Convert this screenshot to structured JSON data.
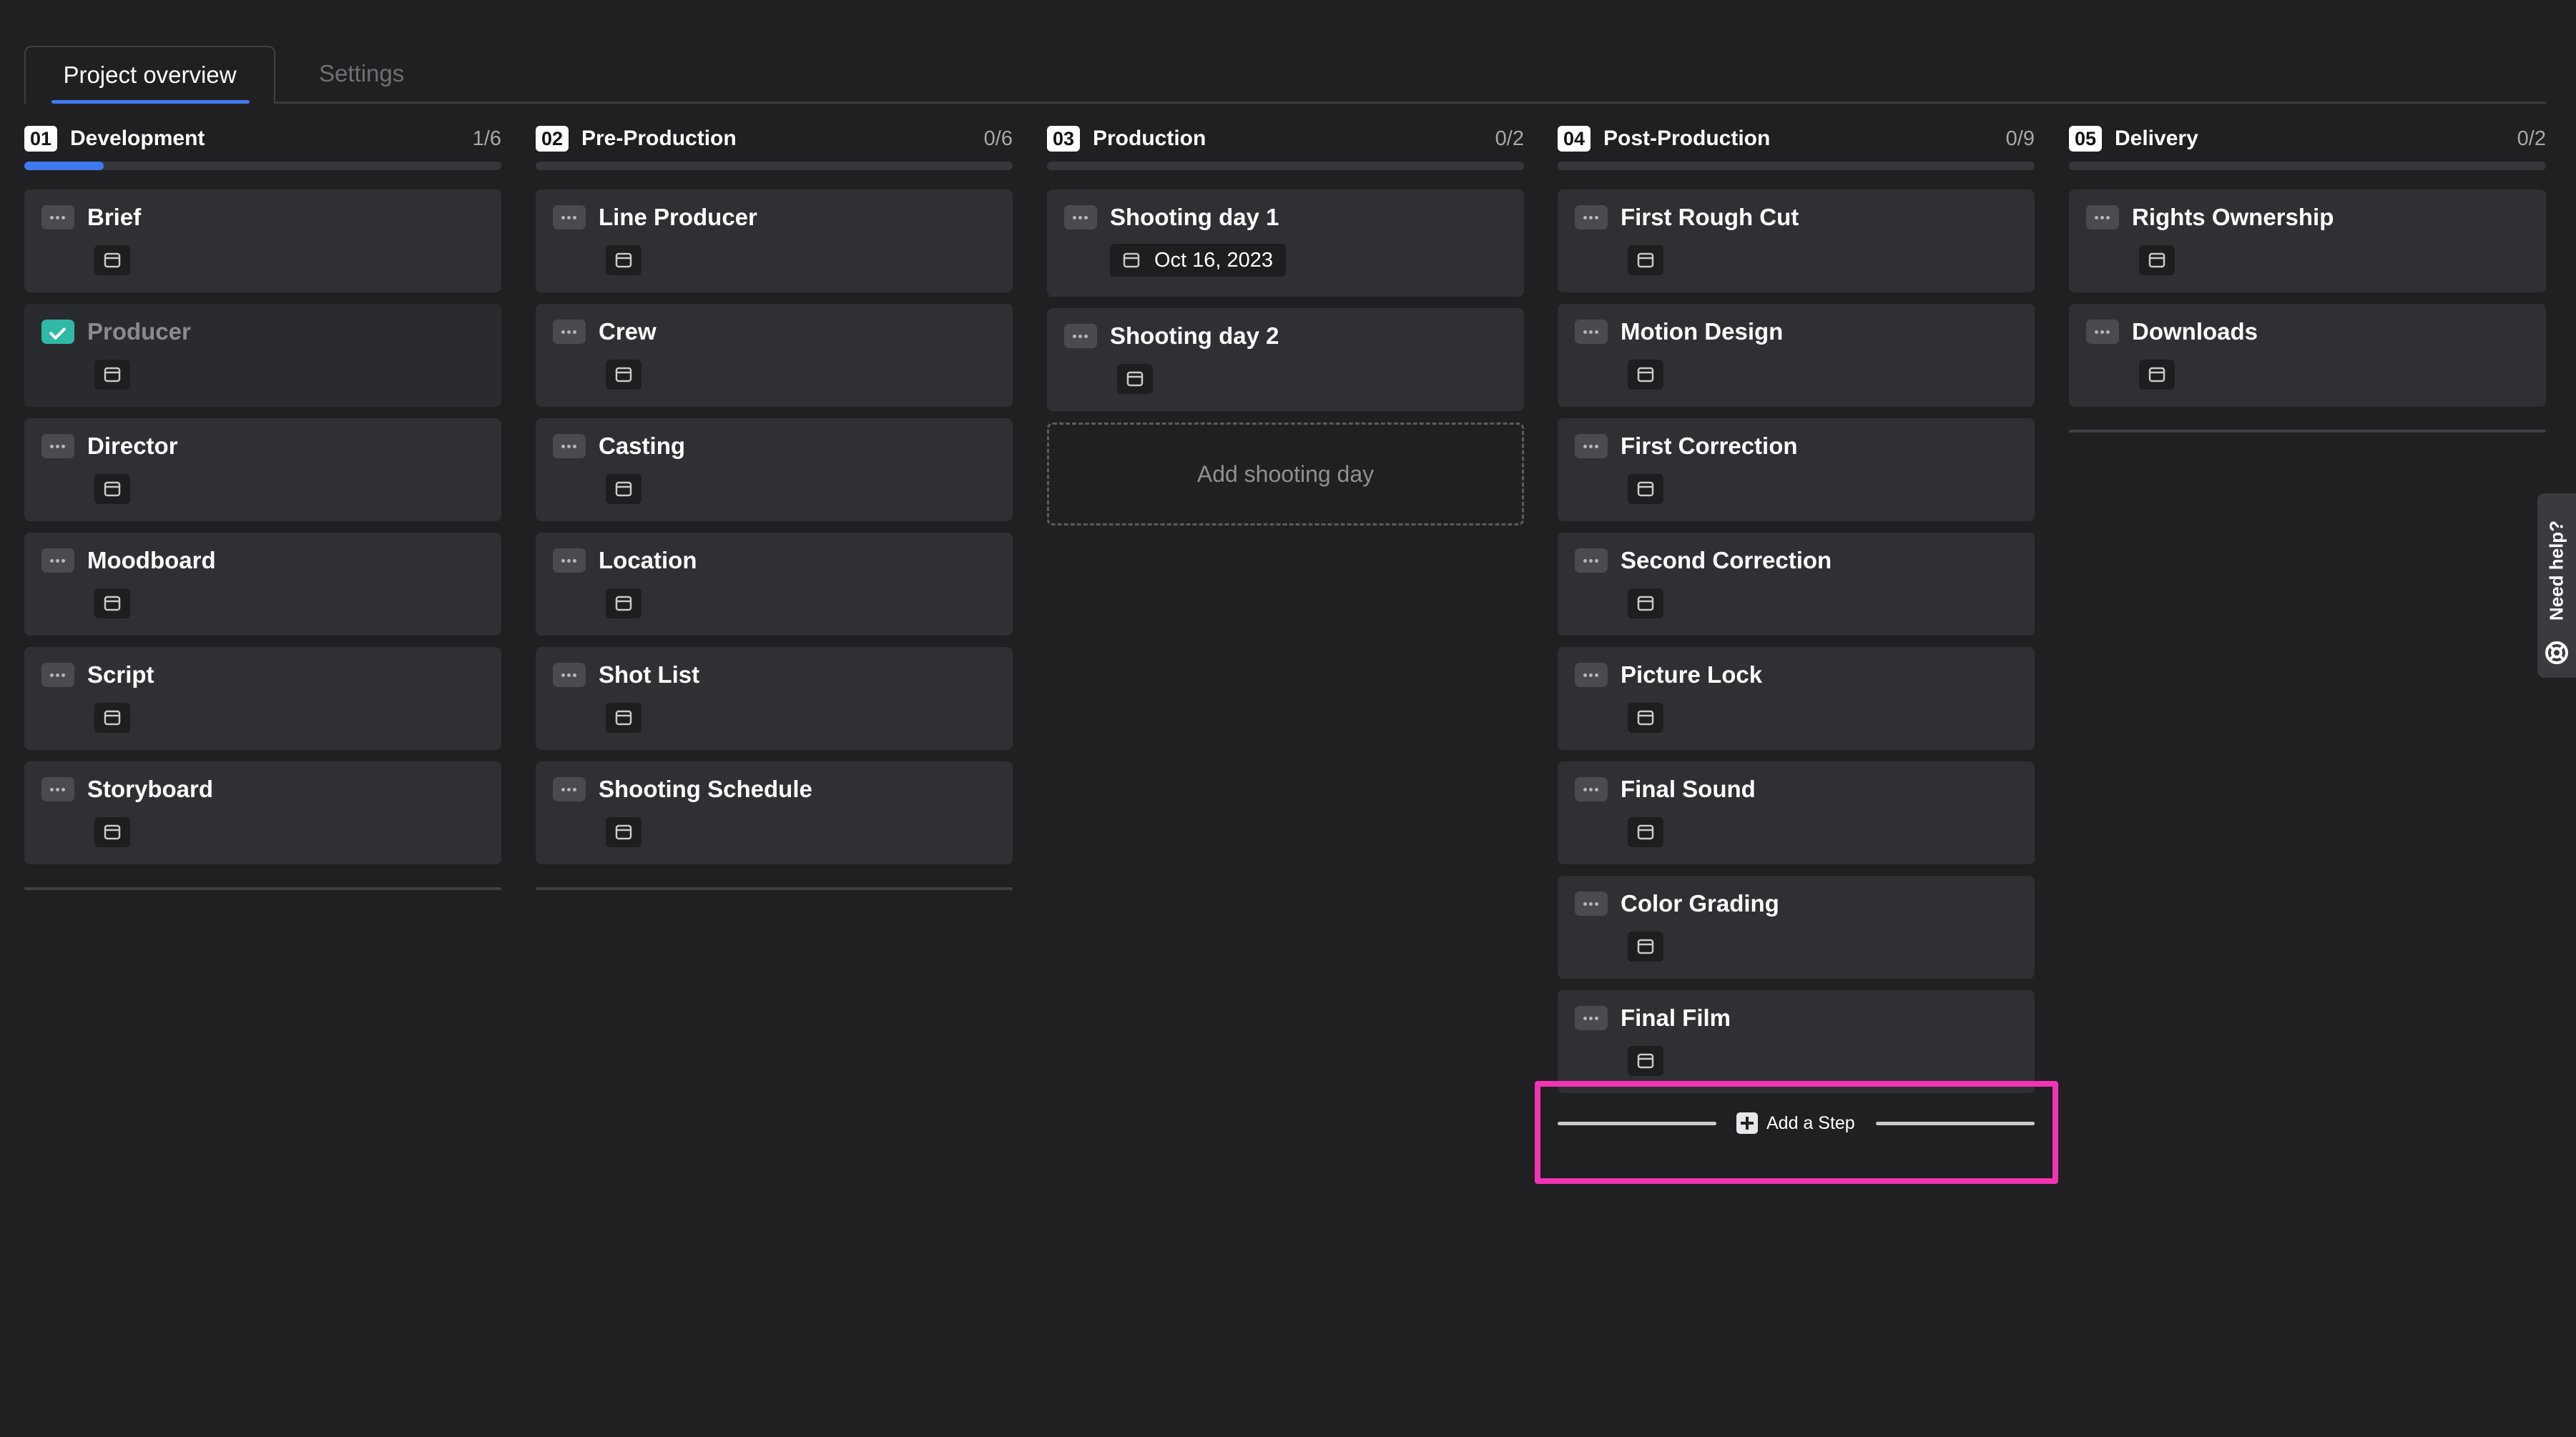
{
  "tabs": [
    {
      "label": "Project overview",
      "active": true
    },
    {
      "label": "Settings",
      "active": false
    }
  ],
  "columns": [
    {
      "number": "01",
      "title": "Development",
      "count": "1/6",
      "progress": 0.1667,
      "cards": [
        {
          "title": "Brief",
          "done": false
        },
        {
          "title": "Producer",
          "done": true
        },
        {
          "title": "Director",
          "done": false
        },
        {
          "title": "Moodboard",
          "done": false
        },
        {
          "title": "Script",
          "done": false
        },
        {
          "title": "Storyboard",
          "done": false
        }
      ]
    },
    {
      "number": "02",
      "title": "Pre-Production",
      "count": "0/6",
      "progress": 0,
      "cards": [
        {
          "title": "Line Producer",
          "done": false
        },
        {
          "title": "Crew",
          "done": false
        },
        {
          "title": "Casting",
          "done": false
        },
        {
          "title": "Location",
          "done": false
        },
        {
          "title": "Shot List",
          "done": false
        },
        {
          "title": "Shooting Schedule",
          "done": false
        }
      ]
    },
    {
      "number": "03",
      "title": "Production",
      "count": "0/2",
      "progress": 0,
      "cards": [
        {
          "title": "Shooting day 1",
          "done": false,
          "date": "Oct 16, 2023"
        },
        {
          "title": "Shooting day 2",
          "done": false
        }
      ],
      "add_label": "Add shooting day"
    },
    {
      "number": "04",
      "title": "Post-Production",
      "count": "0/9",
      "progress": 0,
      "cards": [
        {
          "title": "First Rough Cut",
          "done": false
        },
        {
          "title": "Motion Design",
          "done": false
        },
        {
          "title": "First Correction",
          "done": false
        },
        {
          "title": "Second Correction",
          "done": false
        },
        {
          "title": "Picture Lock",
          "done": false
        },
        {
          "title": "Final Sound",
          "done": false
        },
        {
          "title": "Color Grading",
          "done": false
        },
        {
          "title": "Final Film",
          "done": false
        }
      ]
    },
    {
      "number": "05",
      "title": "Delivery",
      "count": "0/2",
      "progress": 0,
      "cards": [
        {
          "title": "Rights Ownership",
          "done": false
        },
        {
          "title": "Downloads",
          "done": false
        }
      ]
    }
  ],
  "add_step_label": "Add a Step",
  "help_label": "Need help?",
  "colors": {
    "accent": "#3e7bf0",
    "done": "#2fb9a6",
    "highlight": "#f233b3"
  },
  "icons": {
    "card_handle": "more-dots-icon",
    "card_date": "calendar-icon",
    "done": "check-icon",
    "help": "lifebuoy-icon",
    "add": "plus-icon"
  }
}
